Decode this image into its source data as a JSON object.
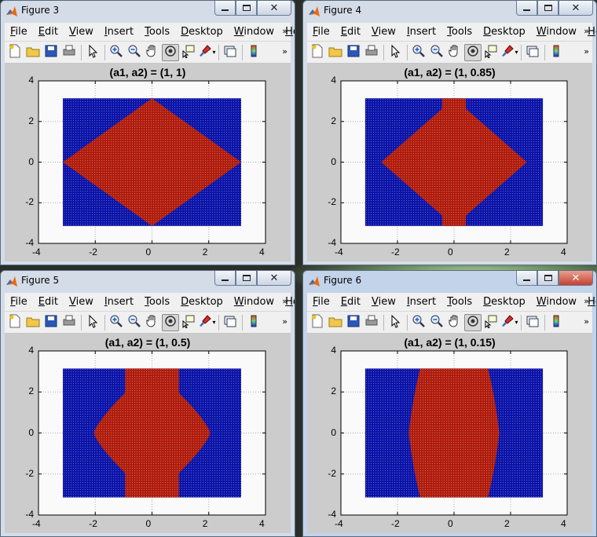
{
  "menu": [
    {
      "label": "File",
      "u": "F",
      "rest": "ile"
    },
    {
      "label": "Edit",
      "u": "E",
      "rest": "dit"
    },
    {
      "label": "View",
      "u": "V",
      "rest": "iew"
    },
    {
      "label": "Insert",
      "u": "I",
      "rest": "nsert"
    },
    {
      "label": "Tools",
      "u": "T",
      "rest": "ools"
    },
    {
      "label": "Desktop",
      "u": "D",
      "rest": "esktop"
    },
    {
      "label": "Window",
      "u": "W",
      "rest": "indow"
    },
    {
      "label": "Help",
      "u": "H",
      "rest": "elp"
    }
  ],
  "toolbar_icons": [
    "new-figure-icon",
    "open-file-icon",
    "save-icon",
    "print-icon",
    "edit-plot-arrow-icon",
    "zoom-in-icon",
    "zoom-out-icon",
    "pan-hand-icon",
    "rotate-3d-icon",
    "data-cursor-icon",
    "brush-icon",
    "link-plot-icon",
    "insert-colorbar-icon"
  ],
  "x_ticks": [
    "-4",
    "-2",
    "0",
    "2",
    "4"
  ],
  "y_ticks": [
    "4",
    "2",
    "0",
    "-2",
    "-4"
  ],
  "colors": {
    "inside": "#b01c0c",
    "outside": "#0b13a8",
    "plot_bg": "#fafafa",
    "figure_bg": "#cccccc"
  },
  "figures": [
    {
      "title": "Figure 3",
      "plot_title": "(a1, a2) = (1, 1)",
      "a1": 1,
      "a2": 1,
      "active": false
    },
    {
      "title": "Figure 4",
      "plot_title": "(a1, a2) = (1, 0.85)",
      "a1": 1,
      "a2": 0.85,
      "active": false
    },
    {
      "title": "Figure 5",
      "plot_title": "(a1, a2) = (1, 0.5)",
      "a1": 1,
      "a2": 0.5,
      "active": false
    },
    {
      "title": "Figure 6",
      "plot_title": "(a1, a2) = (1, 0.15)",
      "a1": 1,
      "a2": 0.15,
      "active": true
    }
  ],
  "chart_data": [
    {
      "type": "scatter",
      "title": "(a1, a2) = (1, 1)",
      "xlim": [
        -4,
        4
      ],
      "ylim": [
        -4,
        4
      ],
      "grid": true,
      "region_x": [
        -3.1416,
        3.1416
      ],
      "region_y": [
        -3.1416,
        3.1416
      ],
      "a1": 1,
      "a2": 1,
      "inside_color": "red",
      "outside_color": "blue"
    },
    {
      "type": "scatter",
      "title": "(a1, a2) = (1, 0.85)",
      "xlim": [
        -4,
        4
      ],
      "ylim": [
        -4,
        4
      ],
      "grid": true,
      "region_x": [
        -3.1416,
        3.1416
      ],
      "region_y": [
        -3.1416,
        3.1416
      ],
      "a1": 1,
      "a2": 0.85,
      "inside_color": "red",
      "outside_color": "blue"
    },
    {
      "type": "scatter",
      "title": "(a1, a2) = (1, 0.5)",
      "xlim": [
        -4,
        4
      ],
      "ylim": [
        -4,
        4
      ],
      "grid": true,
      "region_x": [
        -3.1416,
        3.1416
      ],
      "region_y": [
        -3.1416,
        3.1416
      ],
      "a1": 1,
      "a2": 0.5,
      "inside_color": "red",
      "outside_color": "blue"
    },
    {
      "type": "scatter",
      "title": "(a1, a2) = (1, 0.15)",
      "xlim": [
        -4,
        4
      ],
      "ylim": [
        -4,
        4
      ],
      "grid": true,
      "region_x": [
        -3.1416,
        3.1416
      ],
      "region_y": [
        -3.1416,
        3.1416
      ],
      "a1": 1,
      "a2": 0.15,
      "inside_color": "red",
      "outside_color": "blue"
    }
  ]
}
